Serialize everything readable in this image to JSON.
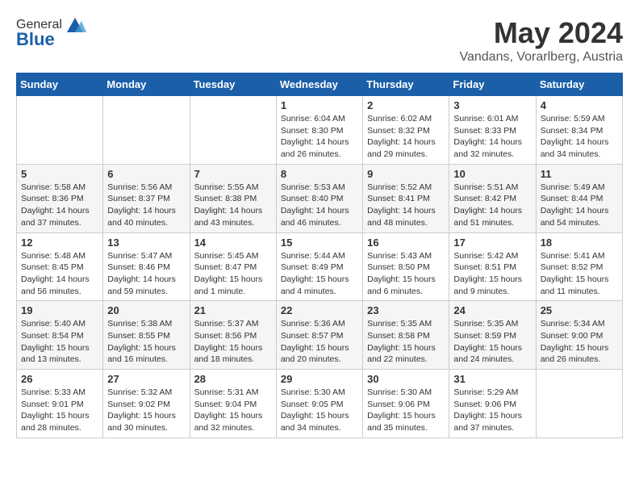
{
  "header": {
    "logo_general": "General",
    "logo_blue": "Blue",
    "month_year": "May 2024",
    "location": "Vandans, Vorarlberg, Austria"
  },
  "weekdays": [
    "Sunday",
    "Monday",
    "Tuesday",
    "Wednesday",
    "Thursday",
    "Friday",
    "Saturday"
  ],
  "weeks": [
    [
      {
        "day": "",
        "info": ""
      },
      {
        "day": "",
        "info": ""
      },
      {
        "day": "",
        "info": ""
      },
      {
        "day": "1",
        "info": "Sunrise: 6:04 AM\nSunset: 8:30 PM\nDaylight: 14 hours\nand 26 minutes."
      },
      {
        "day": "2",
        "info": "Sunrise: 6:02 AM\nSunset: 8:32 PM\nDaylight: 14 hours\nand 29 minutes."
      },
      {
        "day": "3",
        "info": "Sunrise: 6:01 AM\nSunset: 8:33 PM\nDaylight: 14 hours\nand 32 minutes."
      },
      {
        "day": "4",
        "info": "Sunrise: 5:59 AM\nSunset: 8:34 PM\nDaylight: 14 hours\nand 34 minutes."
      }
    ],
    [
      {
        "day": "5",
        "info": "Sunrise: 5:58 AM\nSunset: 8:36 PM\nDaylight: 14 hours\nand 37 minutes."
      },
      {
        "day": "6",
        "info": "Sunrise: 5:56 AM\nSunset: 8:37 PM\nDaylight: 14 hours\nand 40 minutes."
      },
      {
        "day": "7",
        "info": "Sunrise: 5:55 AM\nSunset: 8:38 PM\nDaylight: 14 hours\nand 43 minutes."
      },
      {
        "day": "8",
        "info": "Sunrise: 5:53 AM\nSunset: 8:40 PM\nDaylight: 14 hours\nand 46 minutes."
      },
      {
        "day": "9",
        "info": "Sunrise: 5:52 AM\nSunset: 8:41 PM\nDaylight: 14 hours\nand 48 minutes."
      },
      {
        "day": "10",
        "info": "Sunrise: 5:51 AM\nSunset: 8:42 PM\nDaylight: 14 hours\nand 51 minutes."
      },
      {
        "day": "11",
        "info": "Sunrise: 5:49 AM\nSunset: 8:44 PM\nDaylight: 14 hours\nand 54 minutes."
      }
    ],
    [
      {
        "day": "12",
        "info": "Sunrise: 5:48 AM\nSunset: 8:45 PM\nDaylight: 14 hours\nand 56 minutes."
      },
      {
        "day": "13",
        "info": "Sunrise: 5:47 AM\nSunset: 8:46 PM\nDaylight: 14 hours\nand 59 minutes."
      },
      {
        "day": "14",
        "info": "Sunrise: 5:45 AM\nSunset: 8:47 PM\nDaylight: 15 hours\nand 1 minute."
      },
      {
        "day": "15",
        "info": "Sunrise: 5:44 AM\nSunset: 8:49 PM\nDaylight: 15 hours\nand 4 minutes."
      },
      {
        "day": "16",
        "info": "Sunrise: 5:43 AM\nSunset: 8:50 PM\nDaylight: 15 hours\nand 6 minutes."
      },
      {
        "day": "17",
        "info": "Sunrise: 5:42 AM\nSunset: 8:51 PM\nDaylight: 15 hours\nand 9 minutes."
      },
      {
        "day": "18",
        "info": "Sunrise: 5:41 AM\nSunset: 8:52 PM\nDaylight: 15 hours\nand 11 minutes."
      }
    ],
    [
      {
        "day": "19",
        "info": "Sunrise: 5:40 AM\nSunset: 8:54 PM\nDaylight: 15 hours\nand 13 minutes."
      },
      {
        "day": "20",
        "info": "Sunrise: 5:38 AM\nSunset: 8:55 PM\nDaylight: 15 hours\nand 16 minutes."
      },
      {
        "day": "21",
        "info": "Sunrise: 5:37 AM\nSunset: 8:56 PM\nDaylight: 15 hours\nand 18 minutes."
      },
      {
        "day": "22",
        "info": "Sunrise: 5:36 AM\nSunset: 8:57 PM\nDaylight: 15 hours\nand 20 minutes."
      },
      {
        "day": "23",
        "info": "Sunrise: 5:35 AM\nSunset: 8:58 PM\nDaylight: 15 hours\nand 22 minutes."
      },
      {
        "day": "24",
        "info": "Sunrise: 5:35 AM\nSunset: 8:59 PM\nDaylight: 15 hours\nand 24 minutes."
      },
      {
        "day": "25",
        "info": "Sunrise: 5:34 AM\nSunset: 9:00 PM\nDaylight: 15 hours\nand 26 minutes."
      }
    ],
    [
      {
        "day": "26",
        "info": "Sunrise: 5:33 AM\nSunset: 9:01 PM\nDaylight: 15 hours\nand 28 minutes."
      },
      {
        "day": "27",
        "info": "Sunrise: 5:32 AM\nSunset: 9:02 PM\nDaylight: 15 hours\nand 30 minutes."
      },
      {
        "day": "28",
        "info": "Sunrise: 5:31 AM\nSunset: 9:04 PM\nDaylight: 15 hours\nand 32 minutes."
      },
      {
        "day": "29",
        "info": "Sunrise: 5:30 AM\nSunset: 9:05 PM\nDaylight: 15 hours\nand 34 minutes."
      },
      {
        "day": "30",
        "info": "Sunrise: 5:30 AM\nSunset: 9:06 PM\nDaylight: 15 hours\nand 35 minutes."
      },
      {
        "day": "31",
        "info": "Sunrise: 5:29 AM\nSunset: 9:06 PM\nDaylight: 15 hours\nand 37 minutes."
      },
      {
        "day": "",
        "info": ""
      }
    ]
  ]
}
